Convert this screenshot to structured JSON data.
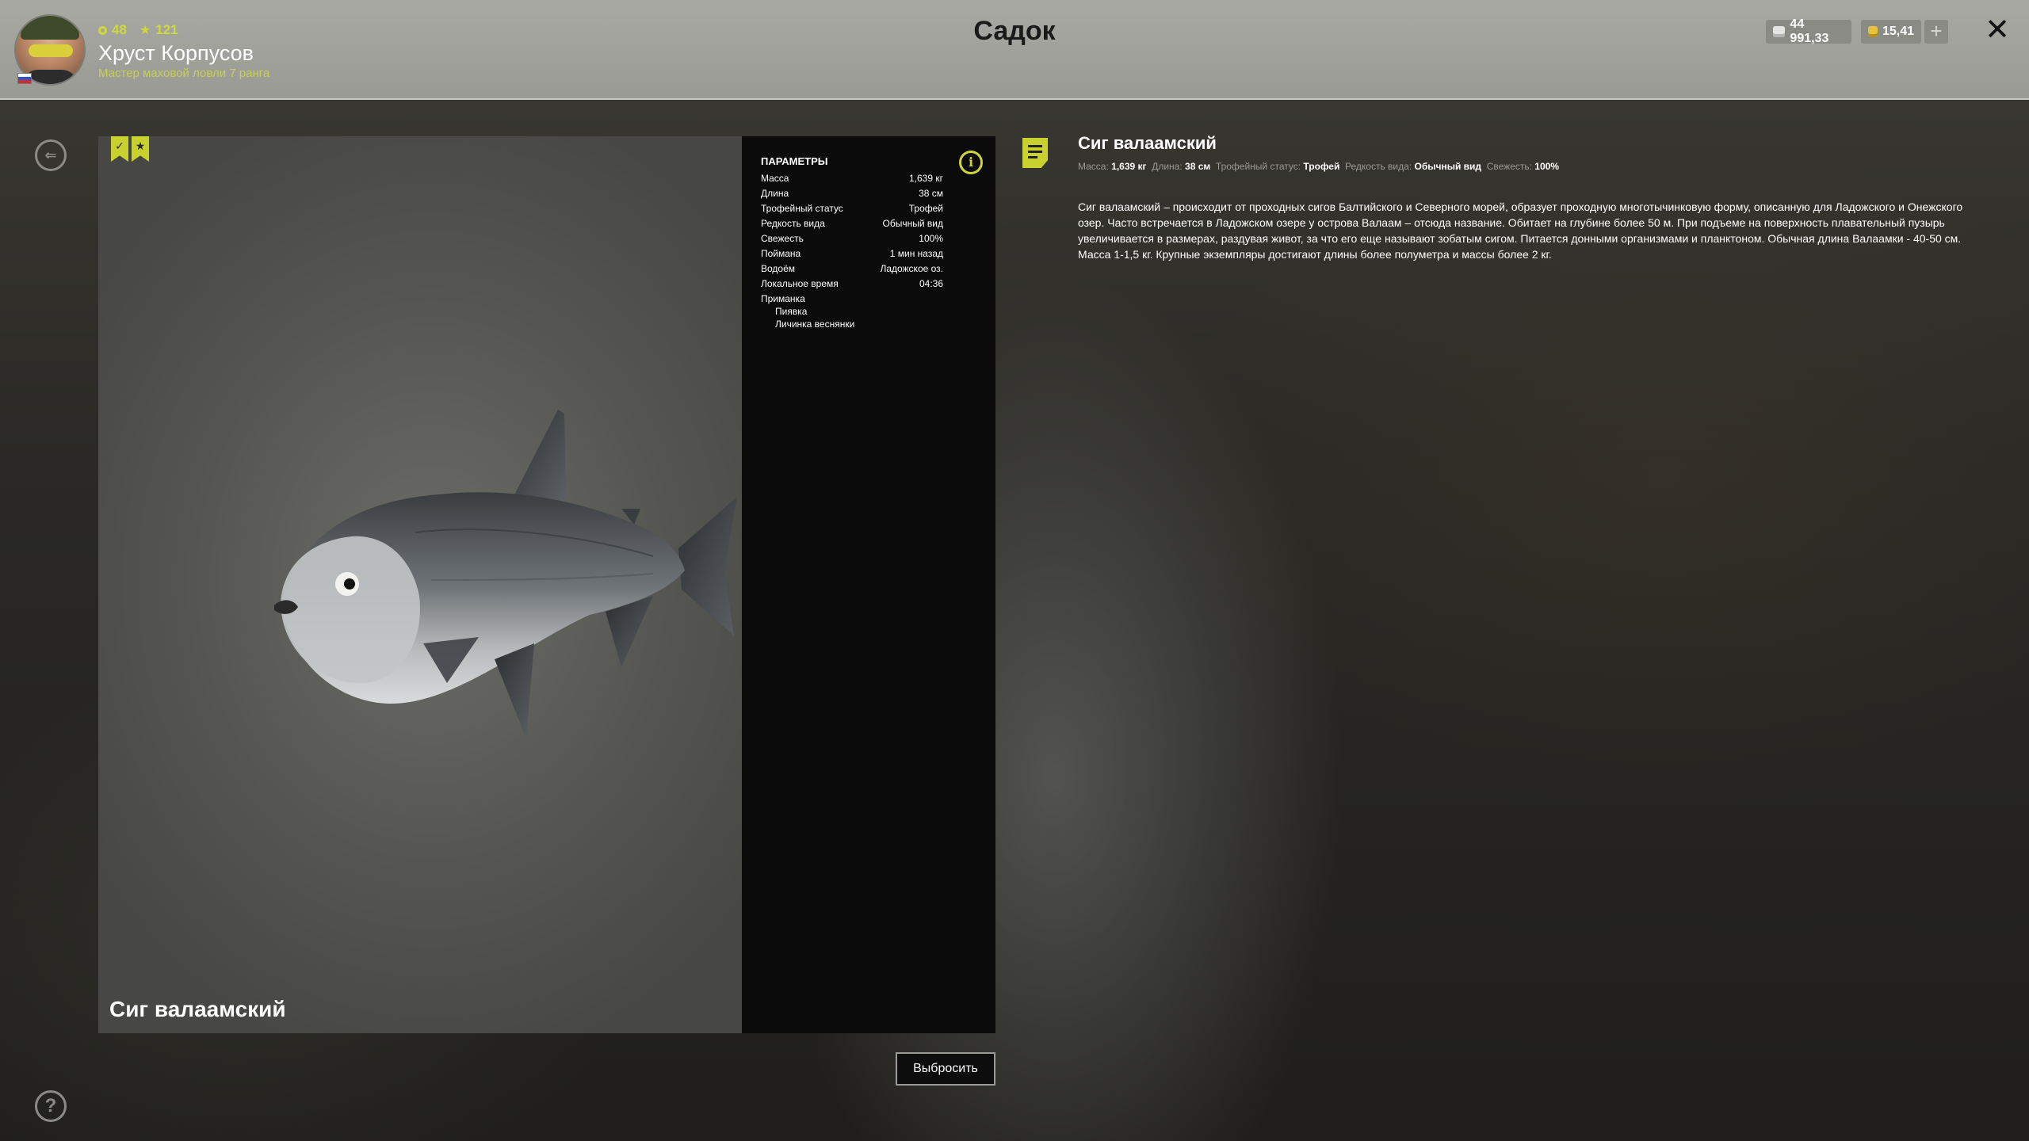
{
  "header": {
    "title": "Садок",
    "player": {
      "name": "Хруст Корпусов",
      "rank": "Мастер маховой ловли 7 ранга",
      "level": "48",
      "stars": "121"
    },
    "currency": {
      "silver": "44 991,33",
      "gold": "15,41"
    },
    "plus_label": "+",
    "close_label": "✕"
  },
  "sidebar": {
    "back_label": "⇐",
    "help_label": "?"
  },
  "fish": {
    "name": "Сиг валаамский",
    "badges": [
      "✓",
      "★"
    ]
  },
  "params": {
    "title": "ПАРАМЕТРЫ",
    "info_label": "i",
    "rows": [
      {
        "label": "Масса",
        "value": "1,639 кг"
      },
      {
        "label": "Длина",
        "value": "38 см"
      },
      {
        "label": "Трофейный статус",
        "value": "Трофей"
      },
      {
        "label": "Редкость вида",
        "value": "Обычный вид"
      },
      {
        "label": "Свежесть",
        "value": "100%"
      },
      {
        "label": "Поймана",
        "value": "1 мин назад"
      },
      {
        "label": "Водоём",
        "value": "Ладожское оз."
      },
      {
        "label": "Локальное время",
        "value": "04:36"
      },
      {
        "label": "Приманка",
        "value": ""
      }
    ],
    "bait": [
      "Пиявка",
      "Личинка веснянки"
    ]
  },
  "description": {
    "title": "Сиг валаамский",
    "meta": [
      {
        "label": "Масса:",
        "value": "1,639 кг"
      },
      {
        "label": "Длина:",
        "value": "38 см"
      },
      {
        "label": "Трофейный статус:",
        "value": "Трофей"
      },
      {
        "label": "Редкость вида:",
        "value": "Обычный вид"
      },
      {
        "label": "Свежесть:",
        "value": "100%"
      }
    ],
    "text": "Сиг валаамский – происходит от проходных сигов Балтийского и Северного морей, образует проходную многотычинковую форму, описанную для Ладожского и Онежского озер. Часто встречается в Ладожском озере у острова Валаам – отсюда название. Обитает на глубине более 50 м. При подъеме на поверхность плавательный пузырь увеличивается в размерах, раздувая живот, за что его еще называют зобатым сигом. Питается донными организмами и планктоном. Обычная длина Валаамки - 40-50 см. Масса 1-1,5 кг. Крупные экземпляры достигают длины более полуметра и массы более 2 кг."
  },
  "actions": {
    "release_label": "Выбросить"
  },
  "colors": {
    "accent": "#c8d12e",
    "header_bg": "#a9a9a4",
    "panel_bg": "#0b0b0b"
  },
  "icons": {
    "back": "back-arrow-icon",
    "help": "question-icon",
    "info": "info-icon",
    "note": "note-icon",
    "close": "close-icon",
    "silver": "silver-coin-icon",
    "gold": "gold-coin-icon"
  }
}
